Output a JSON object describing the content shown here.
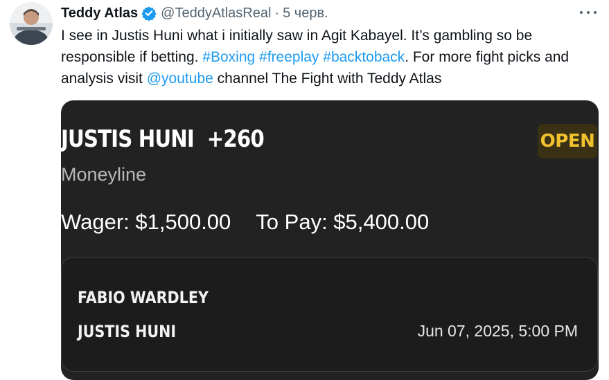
{
  "tweet": {
    "author_name": "Teddy Atlas",
    "handle": "@TeddyAtlasReal",
    "separator": "·",
    "date": "5 черв.",
    "text_part1": "I see in Justis Huni what i initially saw in Agit Kabayel. It’s gambling so be responsible if betting. ",
    "hashtag1": "#Boxing",
    "hashtag2": "#freeplay",
    "hashtag3": "#backtoback",
    "text_part2": ". For more fight picks and analysis visit ",
    "mention": "@youtube",
    "text_part3": " channel The Fight with Teddy Atlas",
    "link_color": "#1d9bf0",
    "verified_color": "#1d9bf0"
  },
  "bet_slip": {
    "pick": "JUSTIS HUNI",
    "odds": "+260",
    "status": "OPEN",
    "market": "Moneyline",
    "wager": "Wager: $1,500.00",
    "to_pay": "To Pay: $5,400.00",
    "fighter1": "FABIO WARDLEY",
    "fighter2": "JUSTIS HUNI",
    "event_date": "Jun 07, 2025, 5:00 PM",
    "status_color": "#f2c12e",
    "card_background": "#222222"
  }
}
